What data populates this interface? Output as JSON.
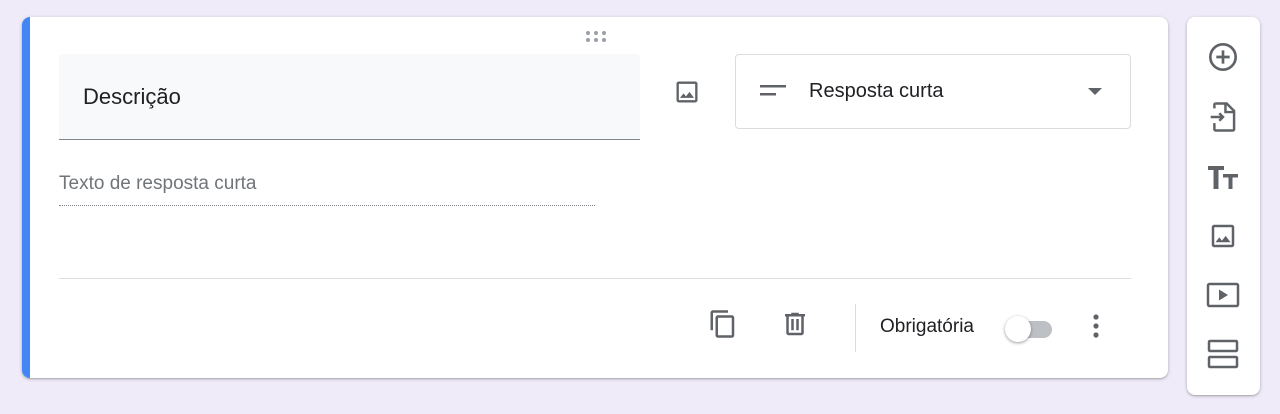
{
  "question": {
    "title": "Descrição",
    "answer_type": "Resposta curta",
    "answer_placeholder": "Texto de resposta curta",
    "required_label": "Obrigatória",
    "required": false
  },
  "colors": {
    "accent": "#4285f4",
    "background": "#f0ebf8",
    "icon": "#5f6368"
  },
  "icons": {
    "drag": "drag-handle-icon",
    "image": "image-icon",
    "short_answer": "short-text-icon",
    "dropdown": "arrow-drop-down-icon",
    "duplicate": "content-copy-icon",
    "delete": "trash-icon",
    "more": "more-vert-icon"
  },
  "side_toolbar": [
    {
      "name": "add-question",
      "icon": "add-circle-icon"
    },
    {
      "name": "import-questions",
      "icon": "import-icon"
    },
    {
      "name": "add-title",
      "icon": "title-icon"
    },
    {
      "name": "add-image",
      "icon": "image-icon"
    },
    {
      "name": "add-video",
      "icon": "video-icon"
    },
    {
      "name": "add-section",
      "icon": "section-icon"
    }
  ]
}
